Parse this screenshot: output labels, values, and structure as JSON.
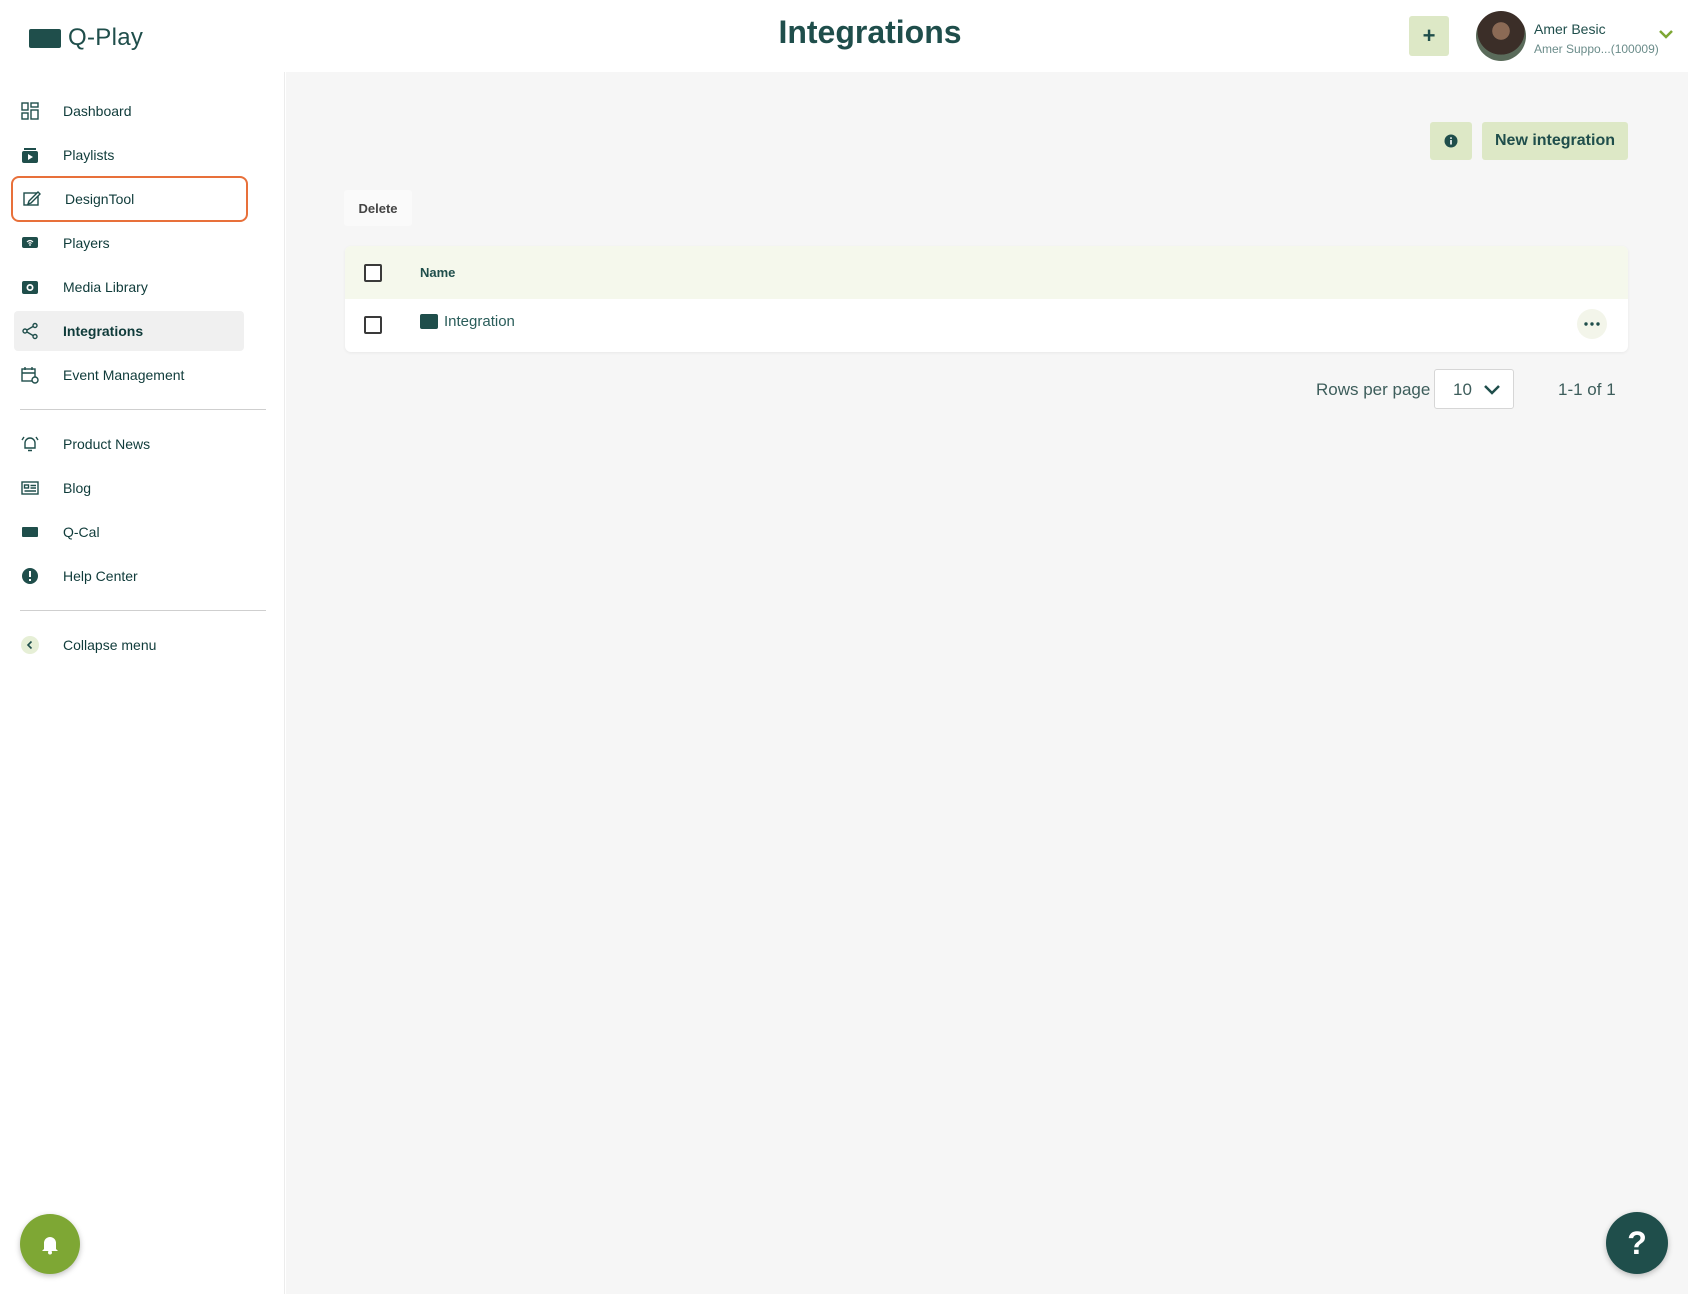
{
  "app": {
    "name": "Q-Play"
  },
  "header": {
    "title": "Integrations",
    "add_label": "+",
    "user": {
      "name": "Amer Besic",
      "subtitle": "Amer Suppo...(100009)"
    }
  },
  "sidebar": {
    "items": [
      {
        "label": "Dashboard",
        "icon": "dashboard-icon"
      },
      {
        "label": "Playlists",
        "icon": "playlist-icon"
      },
      {
        "label": "DesignTool",
        "icon": "design-tool-icon"
      },
      {
        "label": "Players",
        "icon": "players-icon"
      },
      {
        "label": "Media Library",
        "icon": "media-library-icon"
      },
      {
        "label": "Integrations",
        "icon": "share-icon"
      },
      {
        "label": "Event Management",
        "icon": "calendar-icon"
      }
    ],
    "secondary": [
      {
        "label": "Product News",
        "icon": "bell-ring-icon"
      },
      {
        "label": "Blog",
        "icon": "newspaper-icon"
      },
      {
        "label": "Q-Cal",
        "icon": "q-cal-icon"
      },
      {
        "label": "Help Center",
        "icon": "alert-circle-icon"
      }
    ],
    "collapse_label": "Collapse menu"
  },
  "main": {
    "new_button": "New integration",
    "delete_button": "Delete",
    "table": {
      "column_name": "Name",
      "rows": [
        {
          "name": "Integration"
        }
      ]
    },
    "pagination": {
      "rows_per_page_label": "Rows per page",
      "rows_per_page_value": "10",
      "range": "1-1 of 1"
    }
  },
  "help_button": "?",
  "colors": {
    "primary": "#1f4e4b",
    "accent_light": "#dde8c6",
    "green": "#7ea734",
    "highlight": "#e8703a"
  }
}
